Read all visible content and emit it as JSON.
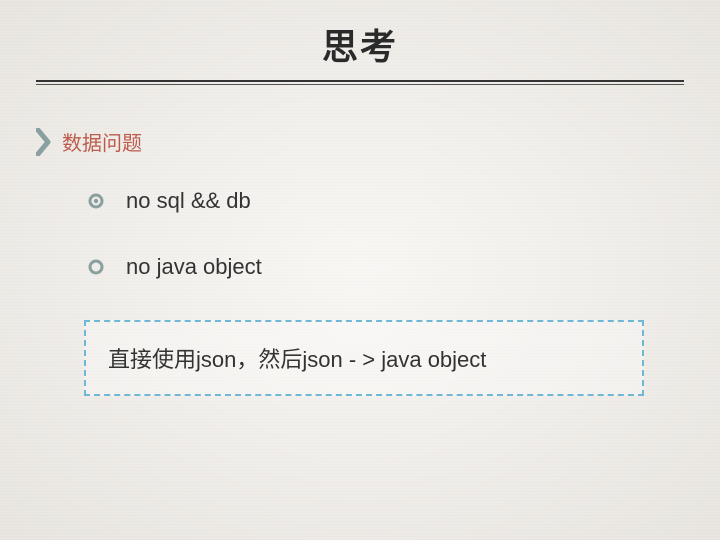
{
  "title": "思考",
  "section": {
    "title": "数据问题"
  },
  "items": [
    {
      "text": "no sql && db"
    },
    {
      "text": "no java object"
    }
  ],
  "callout": {
    "text": "直接使用json，然后json - > java object"
  },
  "colors": {
    "accent_bullet": "#8aa0a0",
    "section_title": "#bd5b4c",
    "callout_border": "#6fb7d6"
  }
}
